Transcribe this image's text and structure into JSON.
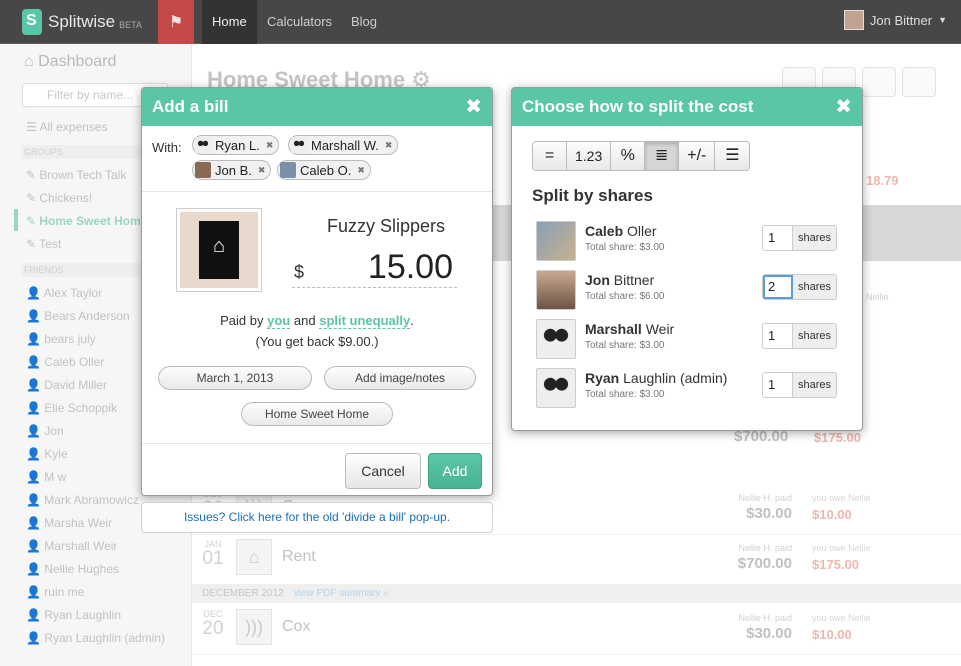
{
  "topbar": {
    "brand": "Splitwise",
    "beta": "BETA",
    "nav": [
      "Home",
      "Calculators",
      "Blog"
    ],
    "user": "Jon Bittner"
  },
  "sidebar": {
    "dashboard": "Dashboard",
    "filter_placeholder": "Filter by name...",
    "all_expenses": "All expenses",
    "groups_header": "GROUPS",
    "groups": [
      "Brown Tech Talk",
      "Chickens!",
      "Home Sweet Home",
      "Test"
    ],
    "friends_header": "FRIENDS",
    "friends": [
      "Alex Taylor",
      "Bears Anderson",
      "bears july",
      "Caleb Oller",
      "David Miller",
      "Elie Schoppik",
      "Jon",
      "Kyle",
      "M w",
      "Mark Abramowicz",
      "Marsha Weir",
      "Marshall Weir",
      "Nellie Hughes",
      "ruin me",
      "Ryan Laughlin",
      "Ryan Laughlin (admin)"
    ]
  },
  "main": {
    "title": "Home Sweet Home",
    "month_label": "DECEMBER 2012",
    "pdf_link": "view PDF summary »",
    "bg_amount_top": "18.79",
    "expenses": [
      {
        "month": "JAN",
        "day": "01",
        "desc": "Rent",
        "paid_label": "Nellie H. paid",
        "paid": "$700.00",
        "owe_label": "you owe Nellie",
        "owe": "$175.00"
      },
      {
        "month": "DEC",
        "day": "20",
        "desc": "Cox",
        "paid_label": "Nellie H. paid",
        "paid": "$30.00",
        "owe_label": "you owe Nellie",
        "owe": "$10.00"
      },
      {
        "month": "",
        "day": "20",
        "desc": "Cox",
        "paid_label": "Nellie H. paid",
        "paid": "$30.00",
        "owe_label": "you owe Nellie",
        "owe": "$10.00"
      }
    ],
    "mid_amount": "$700.00",
    "mid_owe": "$175.00",
    "mid_small": "Nellie"
  },
  "bill_modal": {
    "title": "Add a bill",
    "with_label": "With:",
    "participants": [
      "Ryan L.",
      "Marshall W.",
      "Jon B.",
      "Caleb O."
    ],
    "description": "Fuzzy Slippers",
    "currency": "$",
    "amount": "15.00",
    "paid_by_pre": "Paid by",
    "paid_by": "you",
    "paid_by_mid": "and",
    "split_method": "split unequally",
    "get_back": "(You get back $9.00.)",
    "date": "March 1, 2013",
    "image_notes": "Add image/notes",
    "group": "Home Sweet Home",
    "cancel": "Cancel",
    "add": "Add"
  },
  "issues_bar": "Issues? Click here for the old 'divide a bill' pop-up.",
  "split_modal": {
    "title": "Choose how to split the cost",
    "tabs": [
      "=",
      "1.23",
      "%",
      "≣",
      "+/-",
      "☰"
    ],
    "heading": "Split by shares",
    "unit": "shares",
    "people": [
      {
        "first": "Caleb",
        "last": " Oller",
        "share": "Total share: $3.00",
        "value": "1"
      },
      {
        "first": "Jon",
        "last": " Bittner",
        "share": "Total share: $6.00",
        "value": "2"
      },
      {
        "first": "Marshall",
        "last": " Weir",
        "share": "Total share: $3.00",
        "value": "1"
      },
      {
        "first": "Ryan",
        "last": " Laughlin (admin)",
        "share": "Total share: $3.00",
        "value": "1"
      }
    ]
  },
  "colors": {
    "brand": "#5bc5a7",
    "owe": "#ff652f",
    "link": "#1a6fb5"
  }
}
